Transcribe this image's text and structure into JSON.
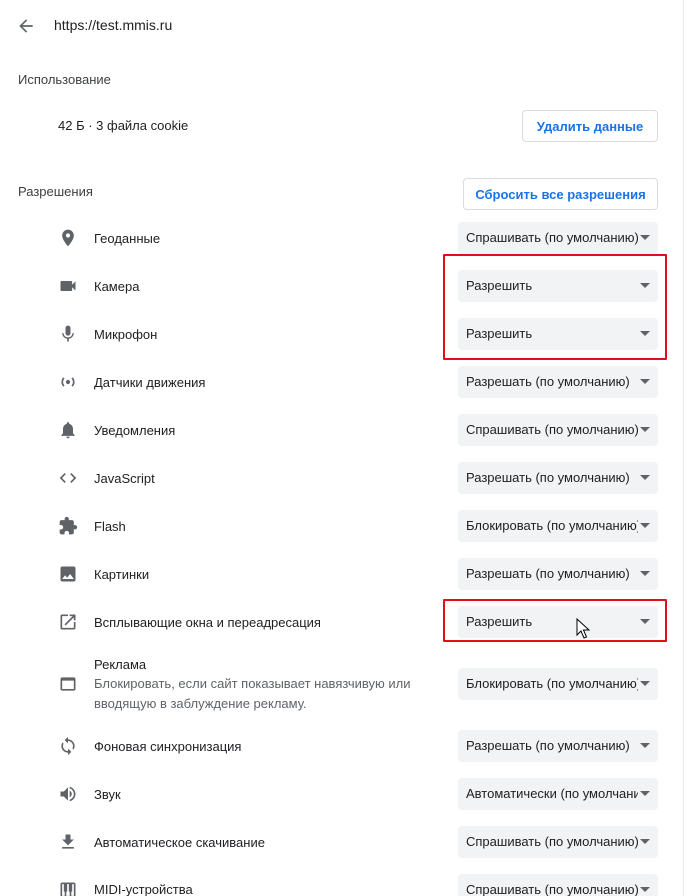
{
  "header": {
    "url": "https://test.mmis.ru"
  },
  "usage": {
    "title": "Использование",
    "summary": "42 Б · 3 файла cookie",
    "clear_button": "Удалить данные"
  },
  "permissions": {
    "title": "Разрешения",
    "reset_button": "Сбросить все разрешения",
    "items": [
      {
        "icon": "location-icon",
        "label": "Геоданные",
        "value": "Спрашивать (по умолчанию)"
      },
      {
        "icon": "camera-icon",
        "label": "Камера",
        "value": "Разрешить"
      },
      {
        "icon": "microphone-icon",
        "label": "Микрофон",
        "value": "Разрешить"
      },
      {
        "icon": "motion-sensors-icon",
        "label": "Датчики движения",
        "value": "Разрешать (по умолчанию)"
      },
      {
        "icon": "bell-icon",
        "label": "Уведомления",
        "value": "Спрашивать (по умолчанию)"
      },
      {
        "icon": "code-icon",
        "label": "JavaScript",
        "value": "Разрешать (по умолчанию)"
      },
      {
        "icon": "puzzle-icon",
        "label": "Flash",
        "value": "Блокировать (по умолчанию)"
      },
      {
        "icon": "image-icon",
        "label": "Картинки",
        "value": "Разрешать (по умолчанию)"
      },
      {
        "icon": "open-in-new-icon",
        "label": "Всплывающие окна и переадресация",
        "value": "Разрешить"
      },
      {
        "icon": "ads-icon",
        "label": "Реклама",
        "sublabel": "Блокировать, если сайт показывает навязчивую или вводящую в заблуждение рекламу.",
        "value": "Блокировать (по умолчанию)"
      },
      {
        "icon": "sync-icon",
        "label": "Фоновая синхронизация",
        "value": "Разрешать (по умолчанию)"
      },
      {
        "icon": "volume-icon",
        "label": "Звук",
        "value": "Автоматически (по умолчанию)"
      },
      {
        "icon": "download-icon",
        "label": "Автоматическое скачивание",
        "value": "Спрашивать (по умолчанию)"
      },
      {
        "icon": "piano-icon",
        "label": "MIDI-устройства",
        "value": "Спрашивать (по умолчанию)"
      }
    ]
  }
}
